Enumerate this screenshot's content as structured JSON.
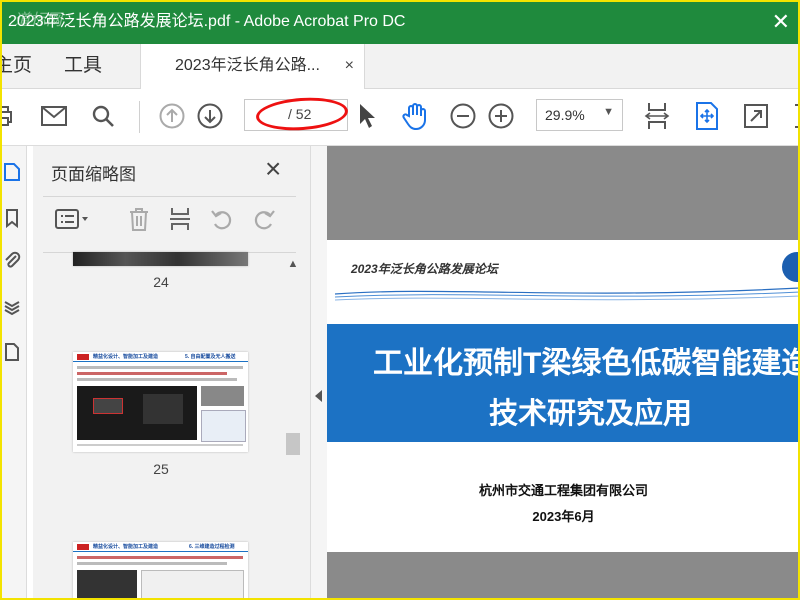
{
  "window": {
    "title": "2023年泛长角公路发展论坛.pdf - Adobe Acrobat Pro DC",
    "watermark": "道标网"
  },
  "nav": {
    "home": "主页",
    "tools": "工具"
  },
  "doc_tab": {
    "label": "2023年泛长角公路...",
    "close": "×"
  },
  "toolbar": {
    "page_current": "",
    "page_total": "/ 52",
    "zoom": "29.9%"
  },
  "thumbnail_panel": {
    "title": "页面缩略图",
    "close": "×",
    "pages": [
      {
        "number": "24"
      },
      {
        "number": "25",
        "heading_left": "精益化设计、智能加工及建造",
        "heading_right": "5. 自由配置及无人搬送"
      },
      {
        "heading_left": "精益化设计、智能加工及建造",
        "heading_right": "6. 三维建造过程检测"
      }
    ]
  },
  "document": {
    "header": "2023年泛长角公路发展论坛",
    "banner_line1": "工业化预制T梁绿色低碳智能建造",
    "banner_line2": "技术研究及应用",
    "company": "杭州市交通工程集团有限公司",
    "date": "2023年6月"
  },
  "colors": {
    "titlebar": "#1f8a3d",
    "banner": "#1c72c4",
    "accent_blue": "#1a73e8",
    "annotation_red": "#e11111",
    "frame_yellow": "#f3e300"
  }
}
